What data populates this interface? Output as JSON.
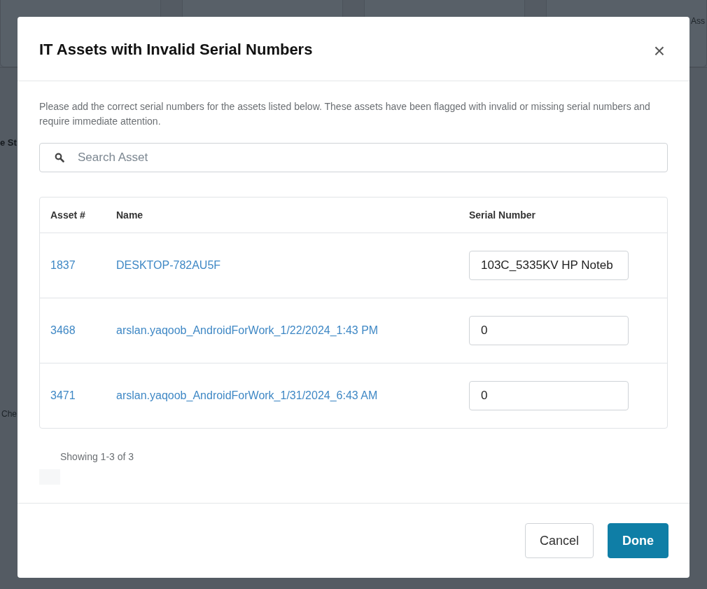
{
  "background": {
    "texts": [
      "e St",
      "Che",
      "Ass"
    ]
  },
  "dialog": {
    "title": "IT Assets with Invalid Serial Numbers",
    "close": "×",
    "description": "Please add the correct serial numbers for the assets listed below. These assets have been flagged with invalid or missing serial numbers and require immediate attention.",
    "search": {
      "placeholder": "Search Asset"
    },
    "table": {
      "columns": [
        "Asset #",
        "Name",
        "Serial Number"
      ],
      "rows": [
        {
          "asset": "1837",
          "name": "DESKTOP-782AU5F",
          "serial": "103C_5335KV HP Noteb"
        },
        {
          "asset": "3468",
          "name": "arslan.yaqoob_AndroidForWork_1/22/2024_1:43 PM",
          "serial": "0"
        },
        {
          "asset": "3471",
          "name": "arslan.yaqoob_AndroidForWork_1/31/2024_6:43 AM",
          "serial": "0"
        }
      ]
    },
    "pagination": "Showing 1-3 of 3",
    "buttons": [
      {
        "label": "Cancel",
        "kind": "secondary"
      },
      {
        "label": "Done",
        "kind": "primary"
      }
    ]
  }
}
